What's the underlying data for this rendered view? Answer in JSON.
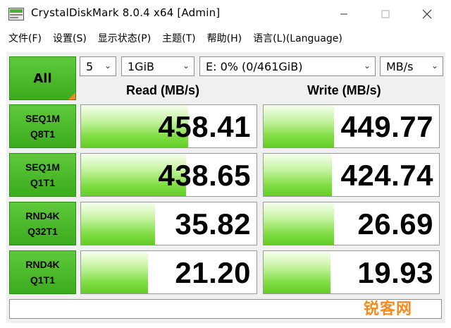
{
  "window": {
    "title": "CrystalDiskMark 8.0.4 x64 [Admin]"
  },
  "menu": [
    {
      "label": "文件(F)"
    },
    {
      "label": "设置(S)"
    },
    {
      "label": "显示状态(P)"
    },
    {
      "label": "主题(T)"
    },
    {
      "label": "帮助(H)"
    },
    {
      "label": "语言(L)(Language)"
    }
  ],
  "controls": {
    "all_label": "All",
    "count": "5",
    "size": "1GiB",
    "drive": "E: 0% (0/461GiB)",
    "unit": "MB/s"
  },
  "headers": {
    "read": "Read (MB/s)",
    "write": "Write (MB/s)"
  },
  "tests": [
    {
      "line1": "SEQ1M",
      "line2": "Q8T1",
      "read": "458.41",
      "write": "449.77",
      "read_fill": 0.61,
      "write_fill": 0.4
    },
    {
      "line1": "SEQ1M",
      "line2": "Q1T1",
      "read": "438.65",
      "write": "424.74",
      "read_fill": 0.6,
      "write_fill": 0.39
    },
    {
      "line1": "RND4K",
      "line2": "Q32T1",
      "read": "35.82",
      "write": "26.69",
      "read_fill": 0.42,
      "write_fill": 0.4
    },
    {
      "line1": "RND4K",
      "line2": "Q1T1",
      "read": "21.20",
      "write": "19.93",
      "read_fill": 0.38,
      "write_fill": 0.38
    }
  ],
  "comment": "",
  "watermark": "锐客网",
  "colors": {
    "tile_green": "#3cab1e",
    "bar_green": "#63cc26",
    "accent_orange": "#f08a1f"
  }
}
